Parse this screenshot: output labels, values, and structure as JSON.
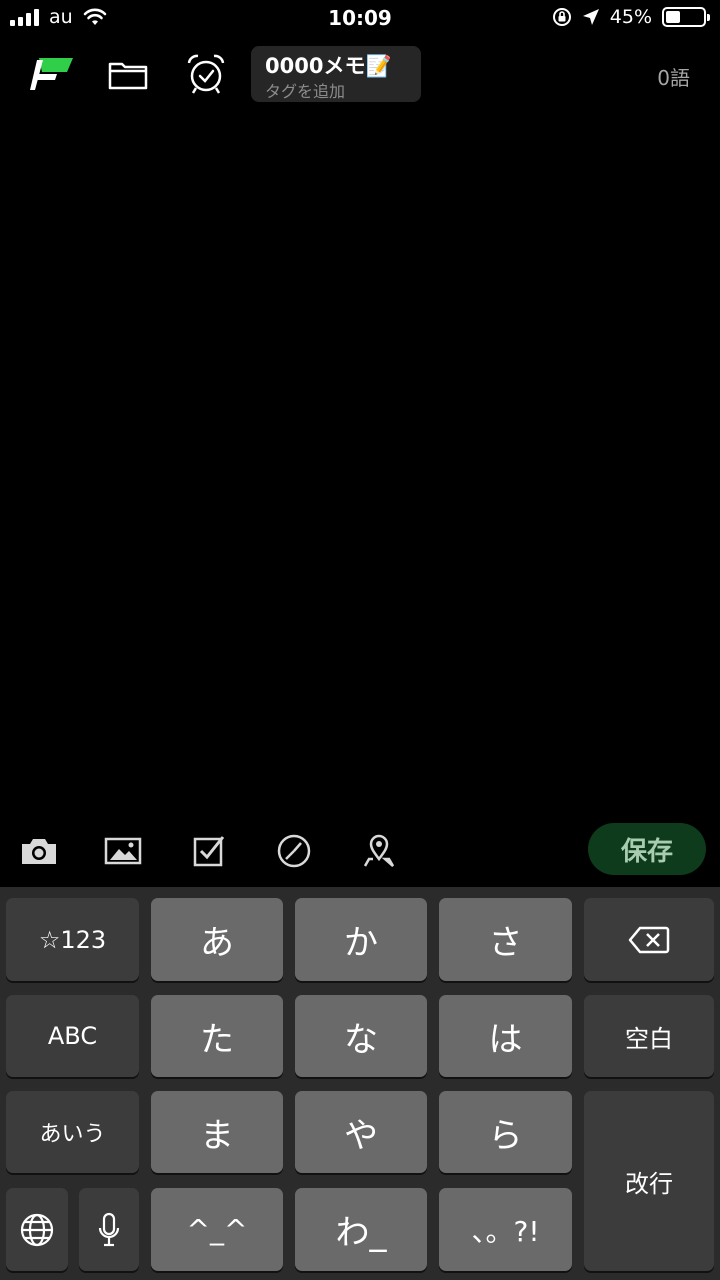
{
  "status_bar": {
    "carrier": "au",
    "time": "10:09",
    "battery_percent": "45%",
    "battery_level": 0.45,
    "icons": [
      "signal-icon",
      "wifi-icon",
      "orientation-lock-icon",
      "location-arrow-icon",
      "battery-icon"
    ]
  },
  "toolbar": {
    "icons": [
      "app-logo-icon",
      "folder-icon",
      "alarm-clock-icon"
    ],
    "note_title": "0000メモ📝",
    "tag_placeholder": "タグを追加",
    "word_count": "0語"
  },
  "accessory_bar": {
    "icons": [
      "camera-icon",
      "image-icon",
      "checkbox-icon",
      "clock-icon",
      "location-pin-icon"
    ],
    "save_label": "保存",
    "save_color": "#0d3b1b"
  },
  "keyboard": {
    "row1": [
      "☆123",
      "あ",
      "か",
      "さ"
    ],
    "row2": [
      "ABC",
      "た",
      "な",
      "は",
      "空白"
    ],
    "row3": [
      "あいう",
      "ま",
      "や",
      "ら"
    ],
    "row4": [
      "^_^",
      "わ_",
      "、。?!"
    ],
    "return_label": "改行",
    "icons": [
      "backspace-icon",
      "globe-icon",
      "microphone-icon"
    ]
  }
}
